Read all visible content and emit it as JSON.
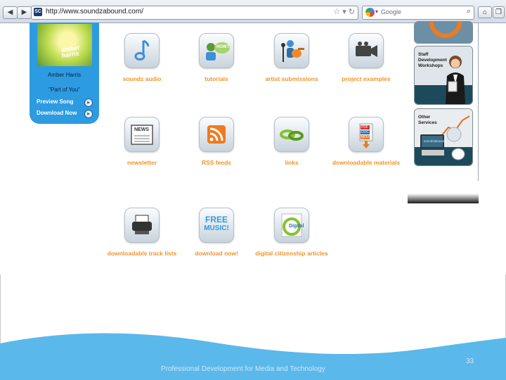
{
  "browser": {
    "url": "http://www.soundzabound.com/",
    "favicon_text": "SC",
    "search_placeholder": "Google",
    "icons": [
      "back-icon",
      "forward-icon",
      "star-icon",
      "dropdown-icon",
      "reload-icon",
      "search-icon",
      "home-icon",
      "bookmark-icon"
    ]
  },
  "promo": {
    "album_text": "amber harris",
    "artist": "Amber Harris",
    "song": "\"Part of You\"",
    "preview_label": "Preview Song",
    "download_label": "Download Now"
  },
  "grid": {
    "items": [
      {
        "label": "soundz audio",
        "icon": "music-note-icon"
      },
      {
        "label": "tutorials",
        "icon": "tutorials-how-icon"
      },
      {
        "label": "artist submissions",
        "icon": "guitar-mic-icon"
      },
      {
        "label": "project examples",
        "icon": "video-camera-icon"
      },
      {
        "label": "newsletter",
        "icon": "newspaper-icon"
      },
      {
        "label": "RSS feeds",
        "icon": "rss-icon"
      },
      {
        "label": "links",
        "icon": "chain-link-icon"
      },
      {
        "label": "downloadable materials",
        "icon": "documents-icon"
      },
      {
        "label": "downloadable track lists",
        "icon": "printer-icon"
      },
      {
        "label": "download now!",
        "icon": "free-music-icon"
      },
      {
        "label": "digital citizenship articles",
        "icon": "digital-icon"
      }
    ],
    "newspaper_badge": "NEWS",
    "tutorials_badge": "HOW?",
    "free_music_line1": "FREE",
    "free_music_line2": "MUSIC!",
    "digital_badge": "Digital",
    "doc_labels": [
      "PDF",
      "DOC",
      "MOV"
    ]
  },
  "right_panel": {
    "staff_card": "Staff Development Workshops",
    "other_card": "Other Services",
    "other_card_logo": "soundzabound"
  },
  "slide": {
    "footer": "Professional Development for Media and Technology",
    "page_number": "33",
    "colors": {
      "wave": "#5bb8ea",
      "accent_label": "#f0942a",
      "promo_bg": "#2d9be2"
    }
  }
}
